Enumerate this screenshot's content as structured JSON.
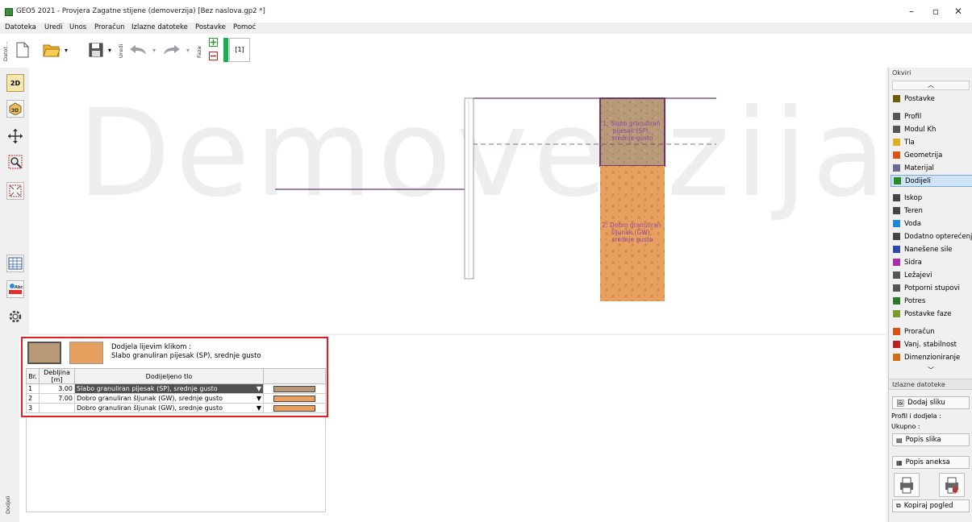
{
  "window": {
    "title": "GEO5 2021 - Provjera Zagatne stijene (demoverzija) [Bez naslova.gp2 *]",
    "minimize": "–",
    "maximize": "▫",
    "close": "✕"
  },
  "menu": [
    "Datoteka",
    "Uredi",
    "Unos",
    "Proračun",
    "Izlazne datoteke",
    "Postavke",
    "Pomoć"
  ],
  "toolbar": {
    "file_group_label": "Datot...",
    "edit_group_label": "Uredi",
    "phase_group_label": "Faza",
    "phase_value": "[1]"
  },
  "left_tools": {
    "view_2d": "2D",
    "view_3d": "3D"
  },
  "canvas": {
    "watermark": "Demoverzija",
    "layer1_label_lines": [
      "1: Slabo granuliran",
      "pijesak (SP),",
      "srednje gusto"
    ],
    "layer2_label_lines": [
      "2: Dobro granuliran",
      "šljunak (GW),",
      "srednje gusto"
    ]
  },
  "right_panel": {
    "frames_header": "Okviri",
    "items": [
      {
        "label": "Postavke",
        "icon": "gear-icon",
        "color": "#6b5a00"
      },
      {
        "label": "Profil",
        "icon": "profile-icon",
        "color": "#555555"
      },
      {
        "label": "Modul Kh",
        "icon": "modulus-icon",
        "color": "#555555"
      },
      {
        "label": "Tla",
        "icon": "soil-icon",
        "color": "#e0b020"
      },
      {
        "label": "Geometrija",
        "icon": "geometry-icon",
        "color": "#e05010"
      },
      {
        "label": "Materijal",
        "icon": "material-icon",
        "color": "#6a6a9a"
      },
      {
        "label": "Dodijeli",
        "icon": "assign-icon",
        "color": "#2a8a2a"
      },
      {
        "label": "Iskop",
        "icon": "excavation-icon",
        "color": "#444444"
      },
      {
        "label": "Teren",
        "icon": "terrain-icon",
        "color": "#444444"
      },
      {
        "label": "Voda",
        "icon": "water-icon",
        "color": "#1a8ad8"
      },
      {
        "label": "Dodatno opterećenje",
        "icon": "surcharge-icon",
        "color": "#444444"
      },
      {
        "label": "Nanešene sile",
        "icon": "forces-icon",
        "color": "#2a4ab0"
      },
      {
        "label": "Sidra",
        "icon": "anchor-icon",
        "color": "#b02ab0"
      },
      {
        "label": "Ležajevi",
        "icon": "supports-icon",
        "color": "#555555"
      },
      {
        "label": "Potporni stupovi",
        "icon": "props-icon",
        "color": "#555555"
      },
      {
        "label": "Potres",
        "icon": "earthquake-icon",
        "color": "#2a7a2a"
      },
      {
        "label": "Postavke faze",
        "icon": "stage-settings-icon",
        "color": "#7a9a2a"
      },
      {
        "label": "Proračun",
        "icon": "analysis-icon",
        "color": "#e05010"
      },
      {
        "label": "Vanj. stabilnost",
        "icon": "stability-icon",
        "color": "#c02020"
      },
      {
        "label": "Dimenzioniranje",
        "icon": "design-icon",
        "color": "#d07010"
      }
    ],
    "output_header": "Izlazne datoteke",
    "add_picture": "Dodaj sliku",
    "profile_assign_label": "Profil i dodjela :",
    "total_label": "Ukupno :",
    "picture_list": "Popis slika",
    "appendix_list": "Popis aneksa",
    "copy_view": "Kopiraj pogled"
  },
  "assign_panel": {
    "side_label": "Dodjeli",
    "hint_line1": "Dodjela lijevim klikom :",
    "hint_line2": "Slabo granuliran pijesak (SP), srednje gusto",
    "columns": [
      "Br.",
      "Debljina [m]",
      "Dodijeljeno tlo",
      ""
    ],
    "rows": [
      {
        "no": "1",
        "thickness": "3.00",
        "soil": "Slabo granuliran pijesak (SP), srednje gusto",
        "color": "#b89a78"
      },
      {
        "no": "2",
        "thickness": "7.00",
        "soil": "Dobro granuliran šljunak (GW), srednje gusto",
        "color": "#e8a060"
      },
      {
        "no": "3",
        "thickness": "",
        "soil": "Dobro granuliran šljunak (GW), srednje gusto",
        "color": "#e8a060"
      }
    ]
  }
}
